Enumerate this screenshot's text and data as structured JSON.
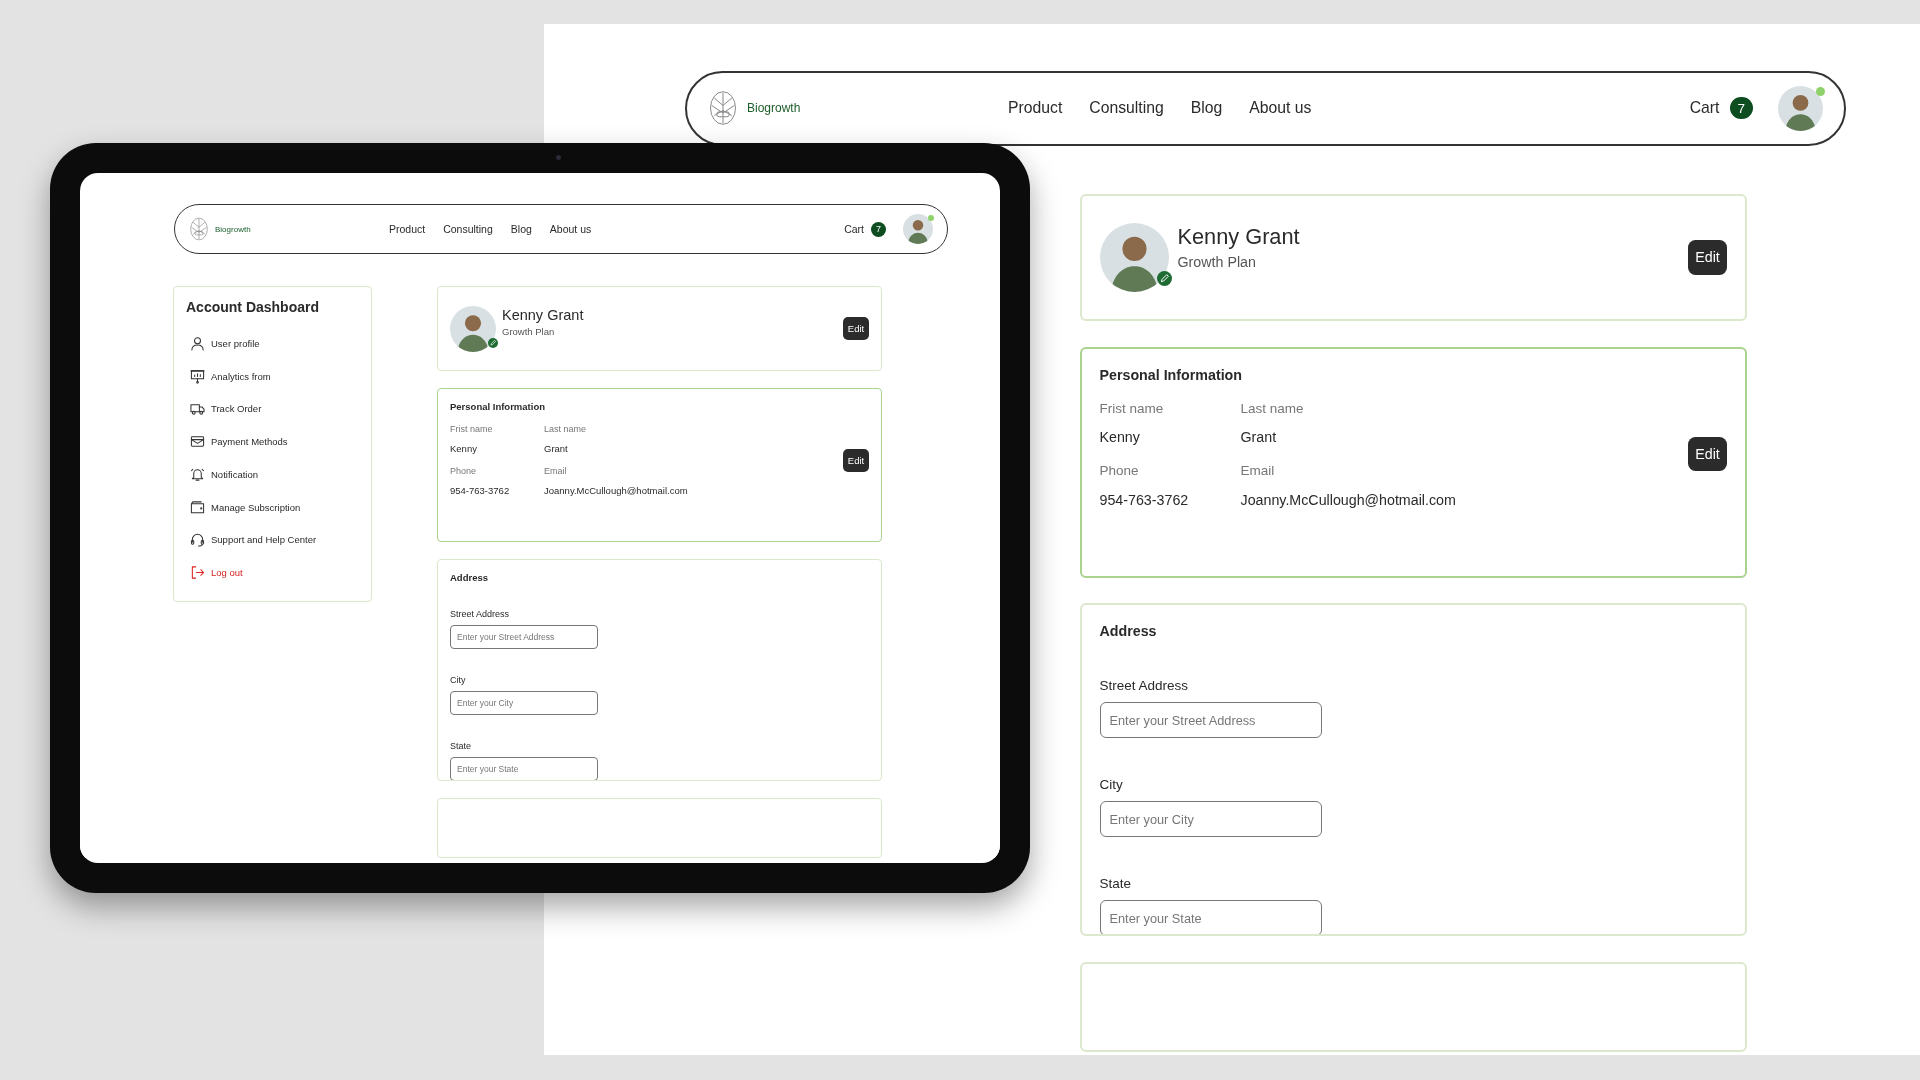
{
  "tablet_screen": {
    "nav": {
      "brand": "Biogrowth",
      "links": [
        "Product",
        "Consulting",
        "Blog",
        "About us"
      ],
      "cart": "Cart",
      "cart_count": "7",
      "online": true
    },
    "sidebar": {
      "title": "Account Dashboard",
      "items": [
        {
          "label": "User profile",
          "kind": "link"
        },
        {
          "label": "Analytics from",
          "kind": "link"
        },
        {
          "label": "Track Order",
          "kind": "link"
        },
        {
          "label": "Payment Methods",
          "kind": "link"
        },
        {
          "label": "Notification",
          "kind": "link"
        },
        {
          "label": "Manage Subscription",
          "kind": "link"
        },
        {
          "label": "Support and Help Center",
          "kind": "link"
        },
        {
          "label": "Log out",
          "kind": "danger"
        }
      ]
    },
    "profile": {
      "name": "Kenny Grant",
      "plan": "Growth Plan",
      "edit": "Edit"
    },
    "personal_information": {
      "title": "Personal Information",
      "edit": "Edit",
      "fields": [
        {
          "label": "Frist name",
          "value": "Kenny"
        },
        {
          "label": "Last name",
          "value": "Grant"
        },
        {
          "label": "Phone",
          "value": "954-763-3762"
        },
        {
          "label": "Email",
          "value": "Joanny.McCullough@hotmail.com"
        }
      ]
    },
    "address": {
      "title": "Address",
      "fields": [
        {
          "label": "Street Address",
          "placeholder": "Enter your Street Address"
        },
        {
          "label": "City",
          "placeholder": "Enter your City"
        },
        {
          "label": "State",
          "placeholder": "Enter your State"
        }
      ]
    }
  },
  "enlarged_view": {
    "nav": {
      "brand": "Biogrowth",
      "links": [
        "Product",
        "Consulting",
        "Blog",
        "About us"
      ],
      "cart": "Cart",
      "cart_count": "7",
      "online": true
    },
    "profile": {
      "name": "Kenny Grant",
      "plan": "Growth Plan",
      "edit": "Edit"
    },
    "personal_information": {
      "title": "Personal Information",
      "edit": "Edit",
      "fields": [
        {
          "label": "Frist name",
          "value": "Kenny"
        },
        {
          "label": "Last name",
          "value": "Grant"
        },
        {
          "label": "Phone",
          "value": "954-763-3762"
        },
        {
          "label": "Email",
          "value": "Joanny.McCullough@hotmail.com"
        }
      ]
    },
    "address": {
      "title": "Address",
      "fields": [
        {
          "label": "Street Address",
          "placeholder": "Enter your Street Address"
        },
        {
          "label": "City",
          "placeholder": "Enter your City"
        },
        {
          "label": "State",
          "placeholder": "Enter your State"
        }
      ]
    }
  }
}
